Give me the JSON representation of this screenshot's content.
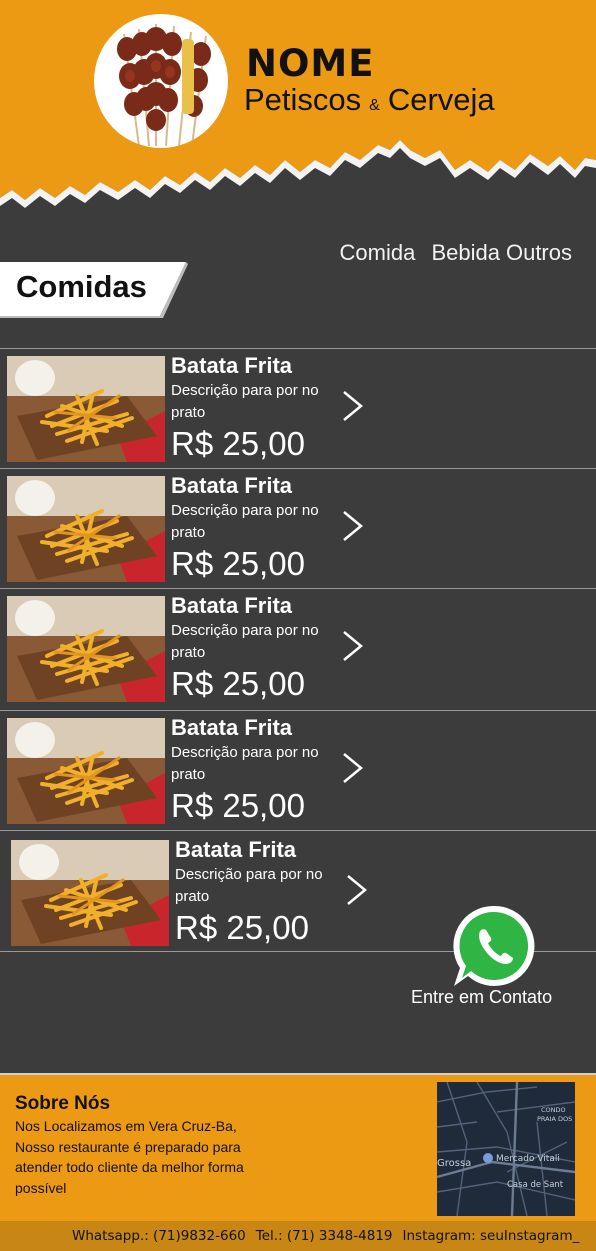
{
  "brand": {
    "name": "NOME",
    "sub_left": "Petiscos",
    "amp": "&",
    "sub_right": "Cerveja"
  },
  "nav": {
    "items": [
      "Comida",
      "Bebida",
      "Outros"
    ]
  },
  "section": {
    "title": "Comidas"
  },
  "items": [
    {
      "name": "Batata Frita",
      "description": "Descrição para por no prato",
      "price": "R$ 25,00"
    },
    {
      "name": "Batata Frita",
      "description": "Descrição para por no prato",
      "price": "R$ 25,00"
    },
    {
      "name": "Batata Frita",
      "description": "Descrição para por no prato",
      "price": "R$ 25,00"
    },
    {
      "name": "Batata Frita",
      "description": "Descrição para por no prato",
      "price": "R$ 25,00"
    },
    {
      "name": "Batata Frita",
      "description": "Descrição para por no prato",
      "price": "R$ 25,00"
    }
  ],
  "contact": {
    "label": "Entre em Contato",
    "icon": "whatsapp-icon"
  },
  "about": {
    "title": "Sobre Nós",
    "text": "Nos Localizamos em Vera Cruz-Ba, Nosso restaurante é preparado para atender todo cliente da melhor forma possível"
  },
  "map": {
    "labels": [
      "CONDO",
      "PRAIA DOS",
      "Grossa",
      "Mercado Vitali",
      "Casa de Sant"
    ]
  },
  "footer": {
    "whatsapp": "Whatsapp.: (71)9832-660",
    "tel": "Tel.: (71) 3348-4819",
    "instagram": "Instagram: seuInstagram_"
  },
  "colors": {
    "orange": "#ec9a14",
    "dark": "#3c3c3c",
    "bottom_bar": "#c88714"
  }
}
